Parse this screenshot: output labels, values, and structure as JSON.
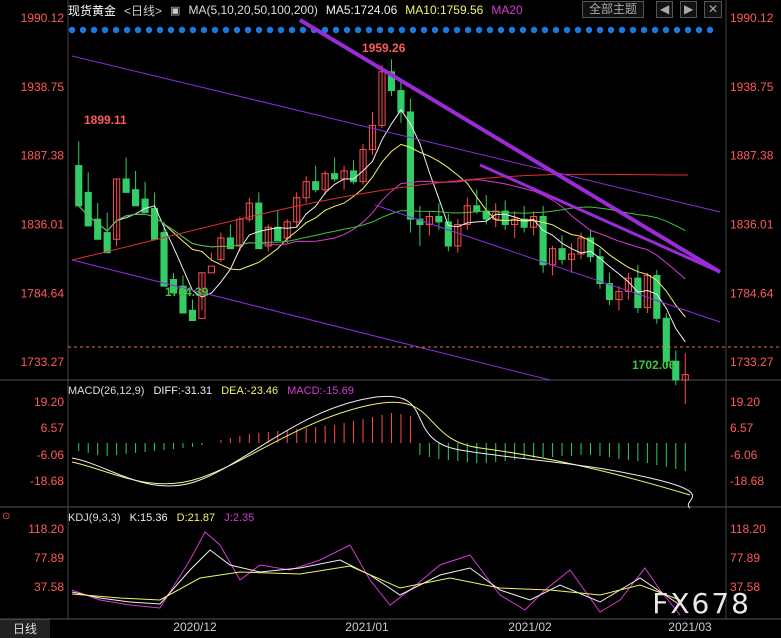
{
  "header": {
    "symbol": "现货黄金",
    "period": "<日线>",
    "ma_label": "MA(5,10,20,50,100,200)",
    "ma5": "MA5:1724.06",
    "ma10": "MA10:1759.56",
    "ma20": "MA20",
    "theme_button": "全部主题",
    "nav_prev": "◀",
    "nav_next": "▶",
    "close": "✕"
  },
  "macd": {
    "label": "MACD(26,12,9)",
    "diff": "DIFF:-31.31",
    "dea": "DEA:-23.46",
    "macd": "MACD:-15.69"
  },
  "kdj": {
    "label": "KDJ(9,3,3)",
    "k": "K:15.36",
    "d": "D:21.87",
    "j": "J:2.35"
  },
  "tab_label": "日线",
  "watermark": "FX678",
  "colors": {
    "up": "#ff4d4d",
    "down": "#33cc66",
    "axis_text": "#ff5a5a",
    "purple": "#9a2bd6"
  },
  "chart_data": {
    "type": "candlestick",
    "y_ticks": [
      "1990.12",
      "1938.75",
      "1887.38",
      "1836.01",
      "1784.64",
      "1733.27"
    ],
    "ylim": [
      1720,
      1990.12
    ],
    "x_ticks": [
      "2020/12",
      "2021/01",
      "2021/02",
      "2021/03"
    ],
    "annotations": [
      {
        "text": "1959.26",
        "value": 1959.26
      },
      {
        "text": "1899.11",
        "value": 1899.11
      },
      {
        "text": "1764.39",
        "value": 1764.39
      },
      {
        "text": "1702.06",
        "value": 1702.06
      }
    ],
    "candles": [
      [
        1880,
        1898,
        1860,
        1850
      ],
      [
        1860,
        1875,
        1840,
        1835
      ],
      [
        1840,
        1852,
        1830,
        1825
      ],
      [
        1830,
        1845,
        1820,
        1815
      ],
      [
        1825,
        1870,
        1820,
        1870
      ],
      [
        1870,
        1886,
        1862,
        1860
      ],
      [
        1862,
        1876,
        1855,
        1850
      ],
      [
        1855,
        1868,
        1848,
        1845
      ],
      [
        1848,
        1860,
        1830,
        1825
      ],
      [
        1830,
        1838,
        1795,
        1790
      ],
      [
        1795,
        1800,
        1790,
        1785
      ],
      [
        1790,
        1798,
        1770,
        1770
      ],
      [
        1772,
        1780,
        1764,
        1764.39
      ],
      [
        1766,
        1800,
        1772,
        1800
      ],
      [
        1800,
        1815,
        1810,
        1805
      ],
      [
        1810,
        1830,
        1808,
        1826
      ],
      [
        1826,
        1836,
        1820,
        1818
      ],
      [
        1820,
        1842,
        1816,
        1840
      ],
      [
        1840,
        1856,
        1838,
        1852
      ],
      [
        1852,
        1860,
        1822,
        1818
      ],
      [
        1820,
        1836,
        1816,
        1834
      ],
      [
        1834,
        1846,
        1826,
        1824
      ],
      [
        1826,
        1840,
        1822,
        1838
      ],
      [
        1838,
        1860,
        1834,
        1856
      ],
      [
        1856,
        1872,
        1852,
        1868
      ],
      [
        1868,
        1880,
        1860,
        1862
      ],
      [
        1862,
        1876,
        1858,
        1874
      ],
      [
        1874,
        1886,
        1868,
        1870
      ],
      [
        1870,
        1880,
        1862,
        1876
      ],
      [
        1876,
        1884,
        1866,
        1868
      ],
      [
        1868,
        1896,
        1866,
        1892
      ],
      [
        1892,
        1920,
        1888,
        1910
      ],
      [
        1910,
        1955,
        1908,
        1950
      ],
      [
        1950,
        1959.26,
        1932,
        1936
      ],
      [
        1936,
        1942,
        1912,
        1920
      ],
      [
        1920,
        1930,
        1830,
        1840
      ],
      [
        1840,
        1850,
        1820,
        1836
      ],
      [
        1836,
        1846,
        1828,
        1842
      ],
      [
        1842,
        1852,
        1832,
        1838
      ],
      [
        1838,
        1844,
        1816,
        1820
      ],
      [
        1820,
        1840,
        1815,
        1836
      ],
      [
        1836,
        1856,
        1832,
        1850
      ],
      [
        1850,
        1862,
        1844,
        1846
      ],
      [
        1846,
        1858,
        1836,
        1840
      ],
      [
        1840,
        1852,
        1834,
        1846
      ],
      [
        1846,
        1854,
        1832,
        1836
      ],
      [
        1836,
        1846,
        1826,
        1840
      ],
      [
        1840,
        1850,
        1830,
        1834
      ],
      [
        1834,
        1846,
        1828,
        1842
      ],
      [
        1842,
        1850,
        1800,
        1806
      ],
      [
        1806,
        1820,
        1798,
        1818
      ],
      [
        1818,
        1828,
        1806,
        1810
      ],
      [
        1810,
        1822,
        1800,
        1814
      ],
      [
        1814,
        1830,
        1810,
        1826
      ],
      [
        1826,
        1832,
        1808,
        1812
      ],
      [
        1812,
        1818,
        1788,
        1792
      ],
      [
        1792,
        1800,
        1776,
        1780
      ],
      [
        1780,
        1790,
        1772,
        1786
      ],
      [
        1786,
        1800,
        1780,
        1796
      ],
      [
        1796,
        1806,
        1770,
        1774
      ],
      [
        1774,
        1800,
        1770,
        1798
      ],
      [
        1798,
        1802,
        1762,
        1766
      ],
      [
        1766,
        1770,
        1730,
        1734
      ],
      [
        1734,
        1742,
        1716,
        1720
      ],
      [
        1720,
        1740,
        1702.06,
        1724
      ]
    ]
  }
}
